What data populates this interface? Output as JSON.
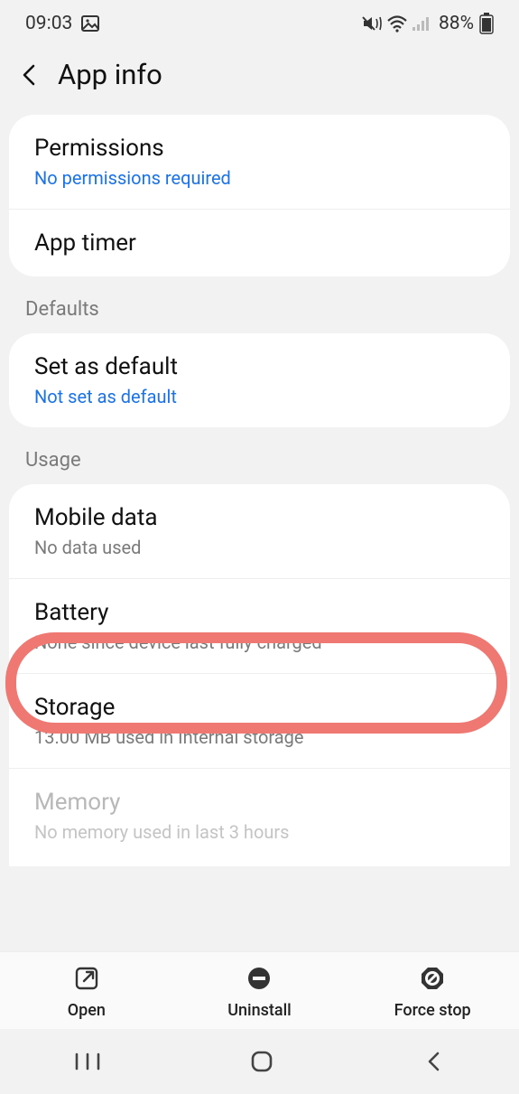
{
  "status": {
    "time": "09:03",
    "battery_pct": "88%"
  },
  "header": {
    "title": "App info"
  },
  "rows": {
    "permissions": {
      "title": "Permissions",
      "sub": "No permissions required"
    },
    "apptimer": {
      "title": "App timer"
    },
    "setdefault": {
      "title": "Set as default",
      "sub": "Not set as default"
    },
    "mobiledata": {
      "title": "Mobile data",
      "sub": "No data used"
    },
    "battery": {
      "title": "Battery",
      "sub": "None since device last fully charged"
    },
    "storage": {
      "title": "Storage",
      "sub": "13.00 MB used in Internal storage"
    },
    "memory": {
      "title": "Memory",
      "sub": "No memory used in last 3 hours"
    }
  },
  "sections": {
    "defaults": "Defaults",
    "usage": "Usage"
  },
  "actions": {
    "open": "Open",
    "uninstall": "Uninstall",
    "forcestop": "Force stop"
  }
}
